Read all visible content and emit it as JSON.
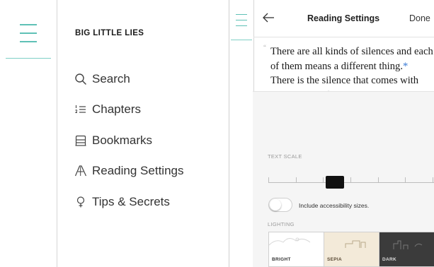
{
  "left": {
    "book_title": "BIG LITTLE LIES",
    "menu": [
      {
        "label": "Search",
        "icon": "search-icon"
      },
      {
        "label": "Chapters",
        "icon": "chapters-icon"
      },
      {
        "label": "Bookmarks",
        "icon": "bookmarks-icon"
      },
      {
        "label": "Reading Settings",
        "icon": "reading-settings-icon"
      },
      {
        "label": "Tips & Secrets",
        "icon": "tips-icon"
      }
    ]
  },
  "right": {
    "nav": {
      "title": "Reading Settings",
      "done_label": "Done"
    },
    "reading": {
      "text_before": "There are all kinds of silences and each of them means a different thing.",
      "footnote_marker": "*",
      "text_after": " There is the silence that comes with morning in a forest, and this is different"
    },
    "text_scale": {
      "label": "TEXT SCALE",
      "steps": 7,
      "selected_step": 4
    },
    "accessibility": {
      "label": "Include accessibility sizes.",
      "enabled": false
    },
    "lighting": {
      "label": "LIGHTING",
      "options": [
        {
          "label": "BRIGHT"
        },
        {
          "label": "SEPIA"
        },
        {
          "label": "DARK"
        }
      ]
    }
  },
  "colors": {
    "accent": "#5fc1b6",
    "footnote": "#3a7bd5",
    "panel_bg": "#f5f5f5",
    "sepia_bg": "#f3ead9",
    "dark_bg": "#3b3b3b"
  }
}
